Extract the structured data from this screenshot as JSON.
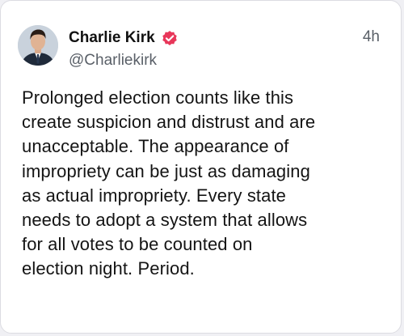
{
  "post": {
    "author_name": "Charlie Kirk",
    "author_handle": "@Charliekirk",
    "timestamp": "4h",
    "verified_badge_icon": "verified-check-icon",
    "avatar_icon": "profile-photo-avatar",
    "body_lines": [
      "Prolonged election counts like this",
      "create suspicion and distrust and are",
      "unacceptable. The appearance of",
      "impropriety can be just as damaging",
      "as actual impropriety. Every state",
      "needs to adopt a system that allows",
      "for all votes to be counted on",
      "election night. Period."
    ]
  },
  "colors": {
    "verified_badge": "#e8375a",
    "handle_text": "#5a6068",
    "card_border": "#dcdce2"
  }
}
